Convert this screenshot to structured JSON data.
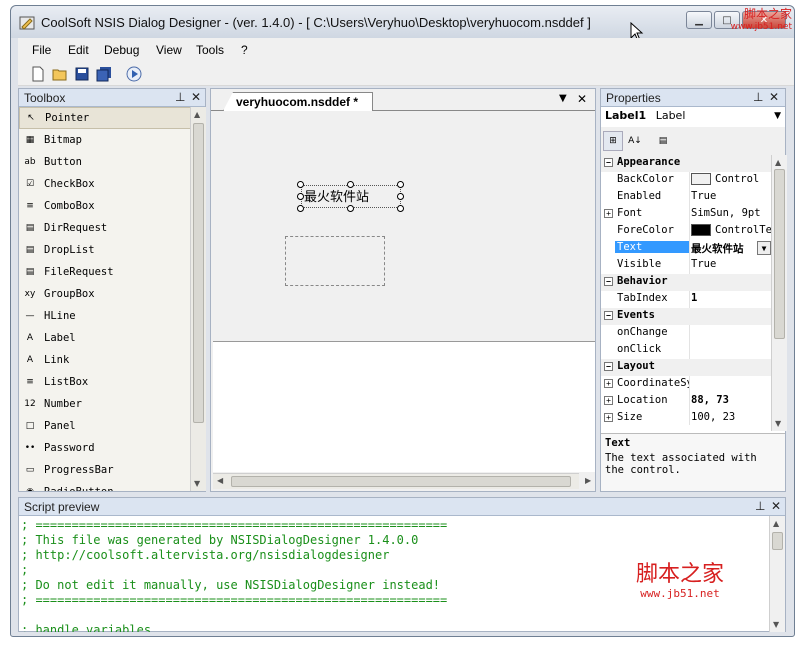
{
  "window": {
    "title": "CoolSoft NSIS Dialog Designer - (ver. 1.4.0) - [ C:\\Users\\Veryhuo\\Desktop\\veryhuocom.nsddef ]"
  },
  "watermark": {
    "top_cn": "脚本之家",
    "top_url": "www.jb51.net",
    "bottom_cn": "脚本之家",
    "bottom_url": "www.jb51.net"
  },
  "menu": [
    "File",
    "Edit",
    "Debug",
    "View",
    "Tools",
    "?"
  ],
  "toolbox": {
    "title": "Toolbox",
    "items": [
      "Pointer",
      "Bitmap",
      "Button",
      "CheckBox",
      "ComboBox",
      "DirRequest",
      "DropList",
      "FileRequest",
      "GroupBox",
      "HLine",
      "Label",
      "Link",
      "ListBox",
      "Number",
      "Panel",
      "Password",
      "ProgressBar",
      "RadioButton"
    ],
    "icons": [
      "↖",
      "▦",
      "ab",
      "☑",
      "≡",
      "▤",
      "▤",
      "▤",
      "xy",
      "—",
      "A",
      "A",
      "≡",
      "12",
      "□",
      "••",
      "▭",
      "◉"
    ]
  },
  "document": {
    "tab_label": "veryhuocom.nsddef *",
    "label_text": "最火软件站"
  },
  "properties": {
    "title": "Properties",
    "selected_object": "Label1",
    "selected_type": "Label",
    "rows": [
      {
        "type": "cat",
        "name": "Appearance",
        "expander": "−"
      },
      {
        "type": "prop",
        "name": "BackColor",
        "value": "Control",
        "swatch": "#f0f0f0"
      },
      {
        "type": "prop",
        "name": "Enabled",
        "value": "True"
      },
      {
        "type": "prop",
        "name": "Font",
        "value": "SimSun, 9pt",
        "expander": "+"
      },
      {
        "type": "prop",
        "name": "ForeColor",
        "value": "ControlText",
        "swatch": "#000000"
      },
      {
        "type": "prop",
        "name": "Text",
        "value": "最火软件站",
        "selected": true
      },
      {
        "type": "prop",
        "name": "Visible",
        "value": "True"
      },
      {
        "type": "cat",
        "name": "Behavior",
        "expander": "−"
      },
      {
        "type": "prop",
        "name": "TabIndex",
        "value": "1",
        "bold": true
      },
      {
        "type": "cat",
        "name": "Events",
        "expander": "−"
      },
      {
        "type": "prop",
        "name": "onChange",
        "value": ""
      },
      {
        "type": "prop",
        "name": "onClick",
        "value": ""
      },
      {
        "type": "cat",
        "name": "Layout",
        "expander": "−"
      },
      {
        "type": "prop",
        "name": "CoordinateSystem",
        "value": "",
        "expander": "+"
      },
      {
        "type": "prop",
        "name": "Location",
        "value": "88, 73",
        "bold": true,
        "expander": "+"
      },
      {
        "type": "prop",
        "name": "Size",
        "value": "100, 23",
        "expander": "+"
      }
    ],
    "desc_title": "Text",
    "desc_text": "The text associated with the control."
  },
  "script": {
    "title": "Script preview",
    "lines": [
      "; =========================================================",
      "; This file was generated by NSISDialogDesigner 1.4.0.0",
      "; http://coolsoft.altervista.org/nsisdialogdesigner",
      ";",
      "; Do not edit it manually, use NSISDialogDesigner instead!",
      "; =========================================================",
      "",
      "; handle variables"
    ]
  }
}
